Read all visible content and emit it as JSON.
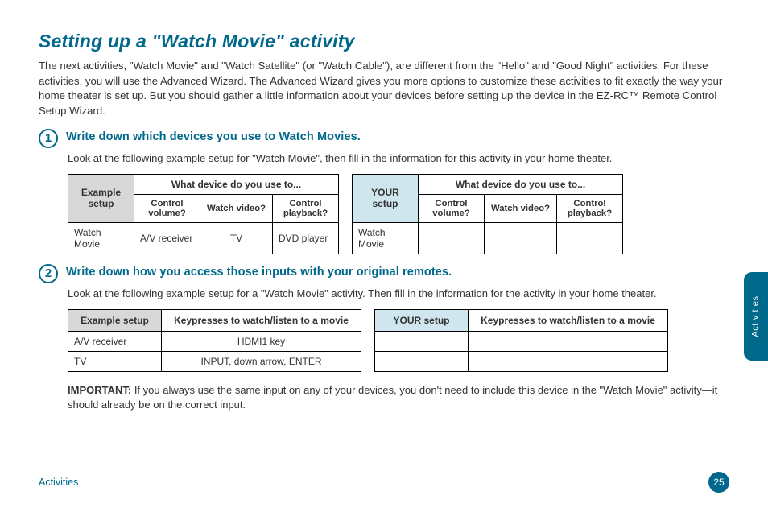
{
  "title": "Setting up a \"Watch Movie\" activity",
  "intro": "The next activities, \"Watch Movie\" and \"Watch Satellite\" (or \"Watch Cable\"), are different from the \"Hello\" and \"Good Night\" activities. For these activities, you will use the Advanced Wizard. The Advanced Wizard gives you more options to customize these activities to fit exactly the way your home theater is set up. But you should gather a little information about your devices before setting up the device in the EZ-RC™ Remote Control Setup Wizard.",
  "step1": {
    "num": "1",
    "head": "Write down which devices you use to Watch Movies.",
    "body": "Look at the following example setup for \"Watch Movie\", then fill in the information for this activity in your home theater.",
    "example_label": "Example setup",
    "your_label": "YOUR setup",
    "top_header": "What device do you use to...",
    "cols": {
      "c1": "Control volume?",
      "c2": "Watch video?",
      "c3": "Control playback?"
    },
    "row": {
      "name": "Watch Movie",
      "v1": "A/V receiver",
      "v2": "TV",
      "v3": "DVD player"
    }
  },
  "step2": {
    "num": "2",
    "head": "Write down how you access those inputs with your original remotes.",
    "body": "Look at the following example setup for a \"Watch Movie\" activity. Then fill in the information for the activity in your home theater.",
    "example_label": "Example setup",
    "your_label": "YOUR setup",
    "top_header": "Keypresses to watch/listen to a movie",
    "rows": [
      {
        "name": "A/V receiver",
        "val": "HDMI1 key"
      },
      {
        "name": "TV",
        "val": "INPUT, down arrow, ENTER"
      }
    ]
  },
  "important_label": "IMPORTANT:",
  "important_text": " If you always use the same input on any of your devices, you don't need to include this device in the \"Watch Movie\" activity—it should already be on the correct input.",
  "footer_label": "Activities",
  "page_num": "25",
  "side_tab": "Act v t es"
}
